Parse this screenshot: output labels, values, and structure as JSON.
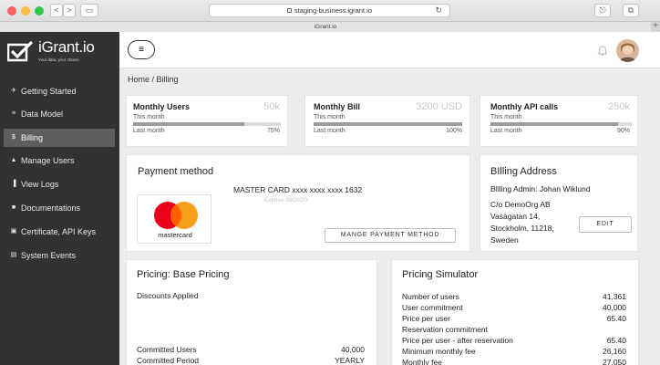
{
  "browser": {
    "url": "staging-business.igrant.io",
    "tab_title": "iGrant.io",
    "back_glyph": "<",
    "forward_glyph": ">",
    "sidebar_glyph": "▭",
    "share_glyph": "⎋",
    "tabs_glyph": "⧉",
    "newtab_glyph": "+",
    "reload_glyph": "↻"
  },
  "app": {
    "logo_text": "iGrant.io",
    "tagline": "Your data, your choice."
  },
  "sidebar": {
    "items": [
      {
        "label": "Getting Started",
        "icon": "rocket-icon",
        "glyph": "✈"
      },
      {
        "label": "Data Model",
        "icon": "list-icon",
        "glyph": "≡"
      },
      {
        "label": "Billing",
        "icon": "dollar-icon",
        "glyph": "$"
      },
      {
        "label": "Manage Users",
        "icon": "user-icon",
        "glyph": "▲"
      },
      {
        "label": "View Logs",
        "icon": "bar-chart-icon",
        "glyph": "▐"
      },
      {
        "label": "Documentations",
        "icon": "book-icon",
        "glyph": "■"
      },
      {
        "label": "Certificate, API Keys",
        "icon": "key-icon",
        "glyph": "▣"
      },
      {
        "label": "System Events",
        "icon": "calendar-icon",
        "glyph": "▤"
      }
    ],
    "active_index": 2
  },
  "header": {
    "menu_glyph": "≡",
    "bell_icon": "bell-icon",
    "avatar_icon": "avatar-icon"
  },
  "breadcrumb": "Home / Billing",
  "stats": [
    {
      "title": "Monthly Users",
      "value": "50k",
      "sub": "This month",
      "last_label": "Last month",
      "percent": "75%",
      "fraction": 0.75
    },
    {
      "title": "Monthly Bill",
      "value": "3200 USD",
      "sub": "This month",
      "last_label": "Last month",
      "percent": "100%",
      "fraction": 1.0
    },
    {
      "title": "Monthly API calls",
      "value": "250k",
      "sub": "This month",
      "last_label": "Last month",
      "percent": "90%",
      "fraction": 0.9
    }
  ],
  "payment": {
    "title": "Payment method",
    "card_number": "MASTER CARD xxxx xxxx xxxx 1632",
    "expires": "Expires 09/2020",
    "brand": "mastercard",
    "button": "MANGE PAYMENT METHOD"
  },
  "billing_address": {
    "title": "BIlling Address",
    "admin": "BIlling Admin: Johan Wiklund",
    "lines": [
      "C/o DemoOrg AB",
      "Vasagatan 14,",
      "Stockholm, 11218,",
      "Sweden"
    ],
    "edit_button": "EDIT"
  },
  "pricing": {
    "title": "Pricing: Base Pricing",
    "discounts": "Discounts Applied",
    "rows": [
      {
        "label": "Committed Users",
        "value": "40,000"
      },
      {
        "label": "Committed Period",
        "value": "YEARLY"
      }
    ]
  },
  "simulator": {
    "title": "Pricing Simulator",
    "rows": [
      {
        "label": "Number of users",
        "value": "41,361"
      },
      {
        "label": "User commitment",
        "value": "40,000"
      },
      {
        "label": "Price per user",
        "value": "65.40"
      },
      {
        "label": "Reservation commitment",
        "value": ""
      },
      {
        "label": "Price per user - after reservation",
        "value": "65.40"
      },
      {
        "label": "Minimum monthly fee",
        "value": "26,160"
      },
      {
        "label": "Monthly fee",
        "value": "27,050"
      }
    ]
  },
  "colors": {
    "sidebar_bg": "#323232",
    "sidebar_active": "#5d5d5d",
    "mastercard_red": "#eb001b",
    "mastercard_orange": "#f79e1b"
  }
}
